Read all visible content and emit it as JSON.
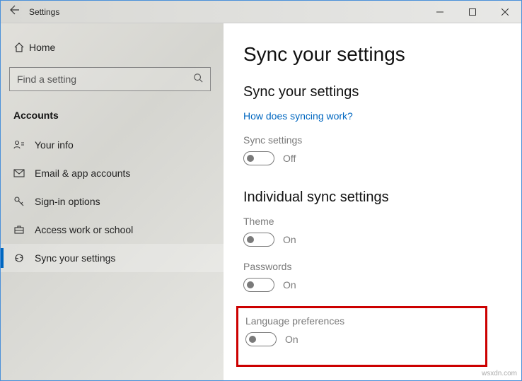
{
  "window": {
    "title": "Settings"
  },
  "sidebar": {
    "home": "Home",
    "search_placeholder": "Find a setting",
    "section": "Accounts",
    "items": [
      {
        "label": "Your info"
      },
      {
        "label": "Email & app accounts"
      },
      {
        "label": "Sign-in options"
      },
      {
        "label": "Access work or school"
      },
      {
        "label": "Sync your settings"
      }
    ]
  },
  "content": {
    "title": "Sync your settings",
    "subtitle": "Sync your settings",
    "link": "How does syncing work?",
    "sync_settings_label": "Sync settings",
    "sync_settings_state": "Off",
    "individual_heading": "Individual sync settings",
    "theme_label": "Theme",
    "theme_state": "On",
    "passwords_label": "Passwords",
    "passwords_state": "On",
    "language_label": "Language preferences",
    "language_state": "On"
  },
  "watermark": "wsxdn.com"
}
